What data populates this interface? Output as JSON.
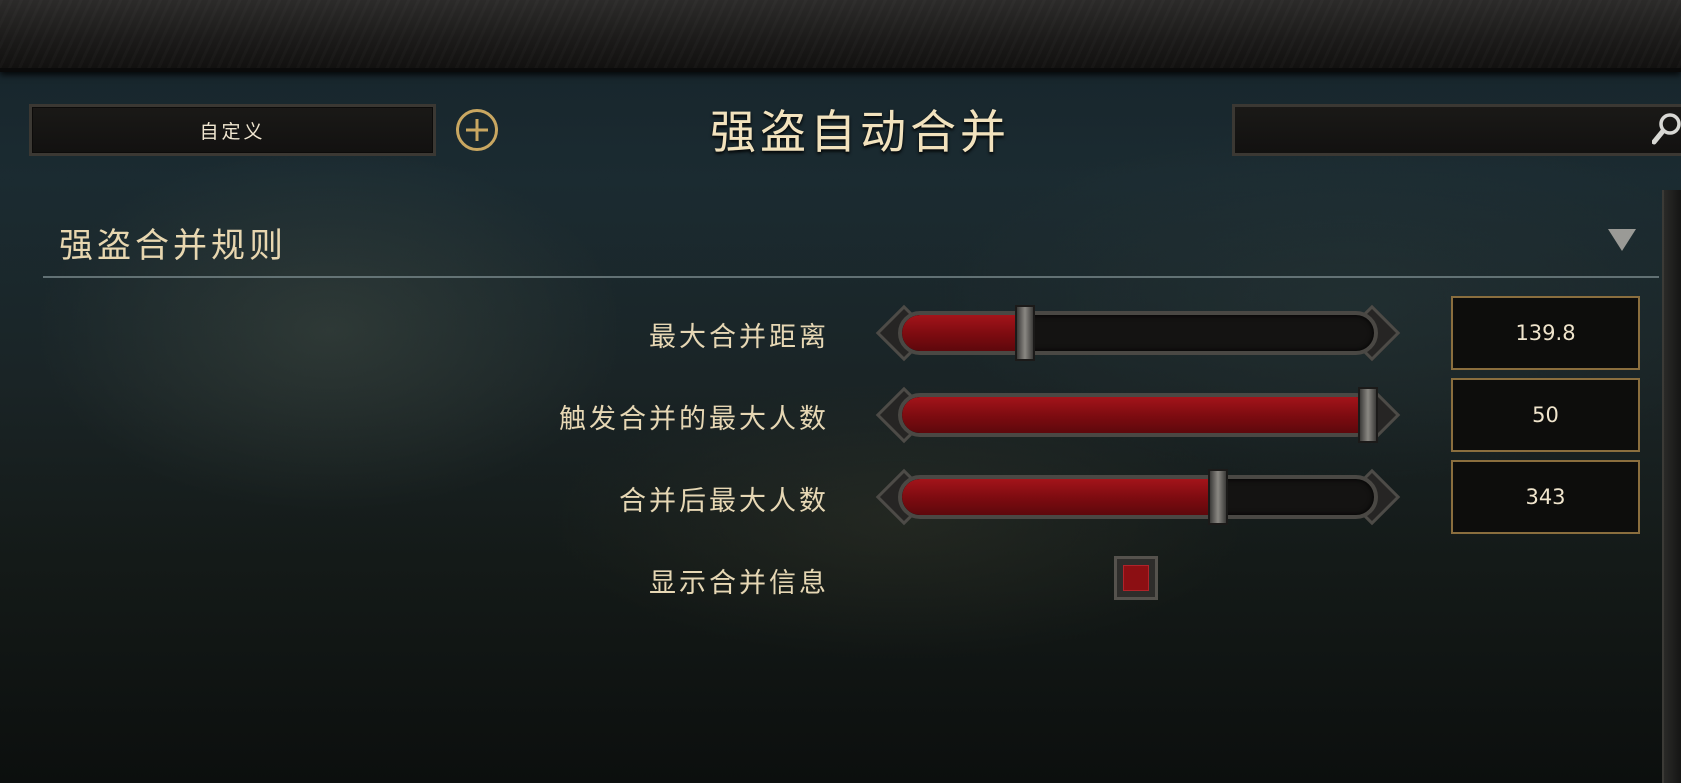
{
  "header": {
    "preset_label": "自定义",
    "page_title": "强盗自动合并",
    "search_value": ""
  },
  "section": {
    "title": "强盗合并规则",
    "expanded": true
  },
  "settings": [
    {
      "label": "最大合并距离",
      "value": "139.8",
      "fill_fraction": 0.26
    },
    {
      "label": "触发合并的最大人数",
      "value": "50",
      "fill_fraction": 1.0
    },
    {
      "label": "合并后最大人数",
      "value": "343",
      "fill_fraction": 0.67
    }
  ],
  "toggle": {
    "label": "显示合并信息",
    "checked": true
  },
  "colors": {
    "accent_gold": "#c9a761",
    "fill_red": "#8c0f13"
  },
  "icons": [
    "add-icon",
    "search-icon",
    "collapse-arrow-icon"
  ]
}
